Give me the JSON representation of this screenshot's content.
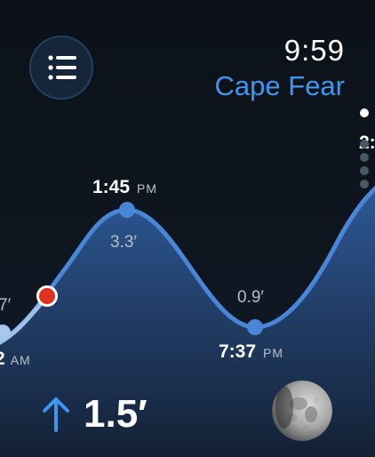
{
  "header": {
    "time": "9:59",
    "location": "Cape Fear"
  },
  "tides": [
    {
      "time": "2",
      "ampm": "AM",
      "height": "7′"
    },
    {
      "time": "1:45",
      "ampm": "PM",
      "height": "3.3′"
    },
    {
      "time": "7:37",
      "ampm": "PM",
      "height": "0.9′"
    },
    {
      "time": "2:",
      "ampm": "",
      "height": ""
    }
  ],
  "current": {
    "direction": "rising",
    "height": "1.5′"
  },
  "pager": {
    "count": 5,
    "active": 0
  },
  "icons": {
    "menu": "menu-list-icon",
    "current_marker": "current-position-dot",
    "direction": "arrow-up-icon",
    "moon": "moon-phase-icon"
  },
  "colors": {
    "accent": "#3d97ee",
    "curve": "#4a86d8",
    "fill_top": "#2e5a98",
    "current_marker": "#e0301e",
    "background": "#0d1219"
  }
}
